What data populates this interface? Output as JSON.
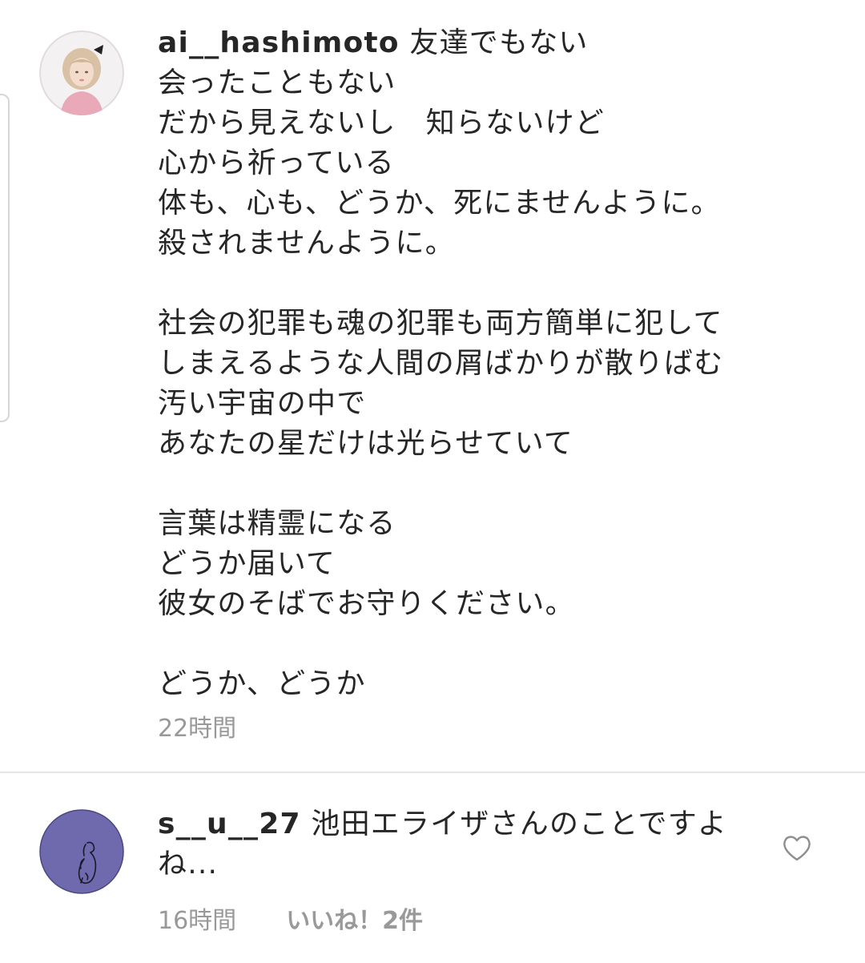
{
  "comments": [
    {
      "username": "ai__hashimoto",
      "first_line": " 友達でもない",
      "rest_lines": "会ったこともない\nだから見えないし　知らないけど\n心から祈っている\n体も、心も、どうか、死にませんように。\n殺されませんように。\n\n社会の犯罪も魂の犯罪も両方簡単に犯して\nしまえるような人間の屑ばかりが散りばむ\n汚い宇宙の中で\nあなたの星だけは光らせていて\n\n言葉は精霊になる\nどうか届いて\n彼女のそばでお守りください。\n\nどうか、どうか",
      "time": "22時間"
    },
    {
      "username": "s__u__27",
      "first_line": " 池田エライザさんのことですよ",
      "rest_lines": "ね...",
      "time": "16時間",
      "likes": "いいね！2件",
      "heart_icon": "heart-outline-icon"
    }
  ],
  "colors": {
    "text": "#262626",
    "meta": "#999999",
    "divider": "#e5e5e5",
    "avatar2_bg": "#6e6aad"
  }
}
